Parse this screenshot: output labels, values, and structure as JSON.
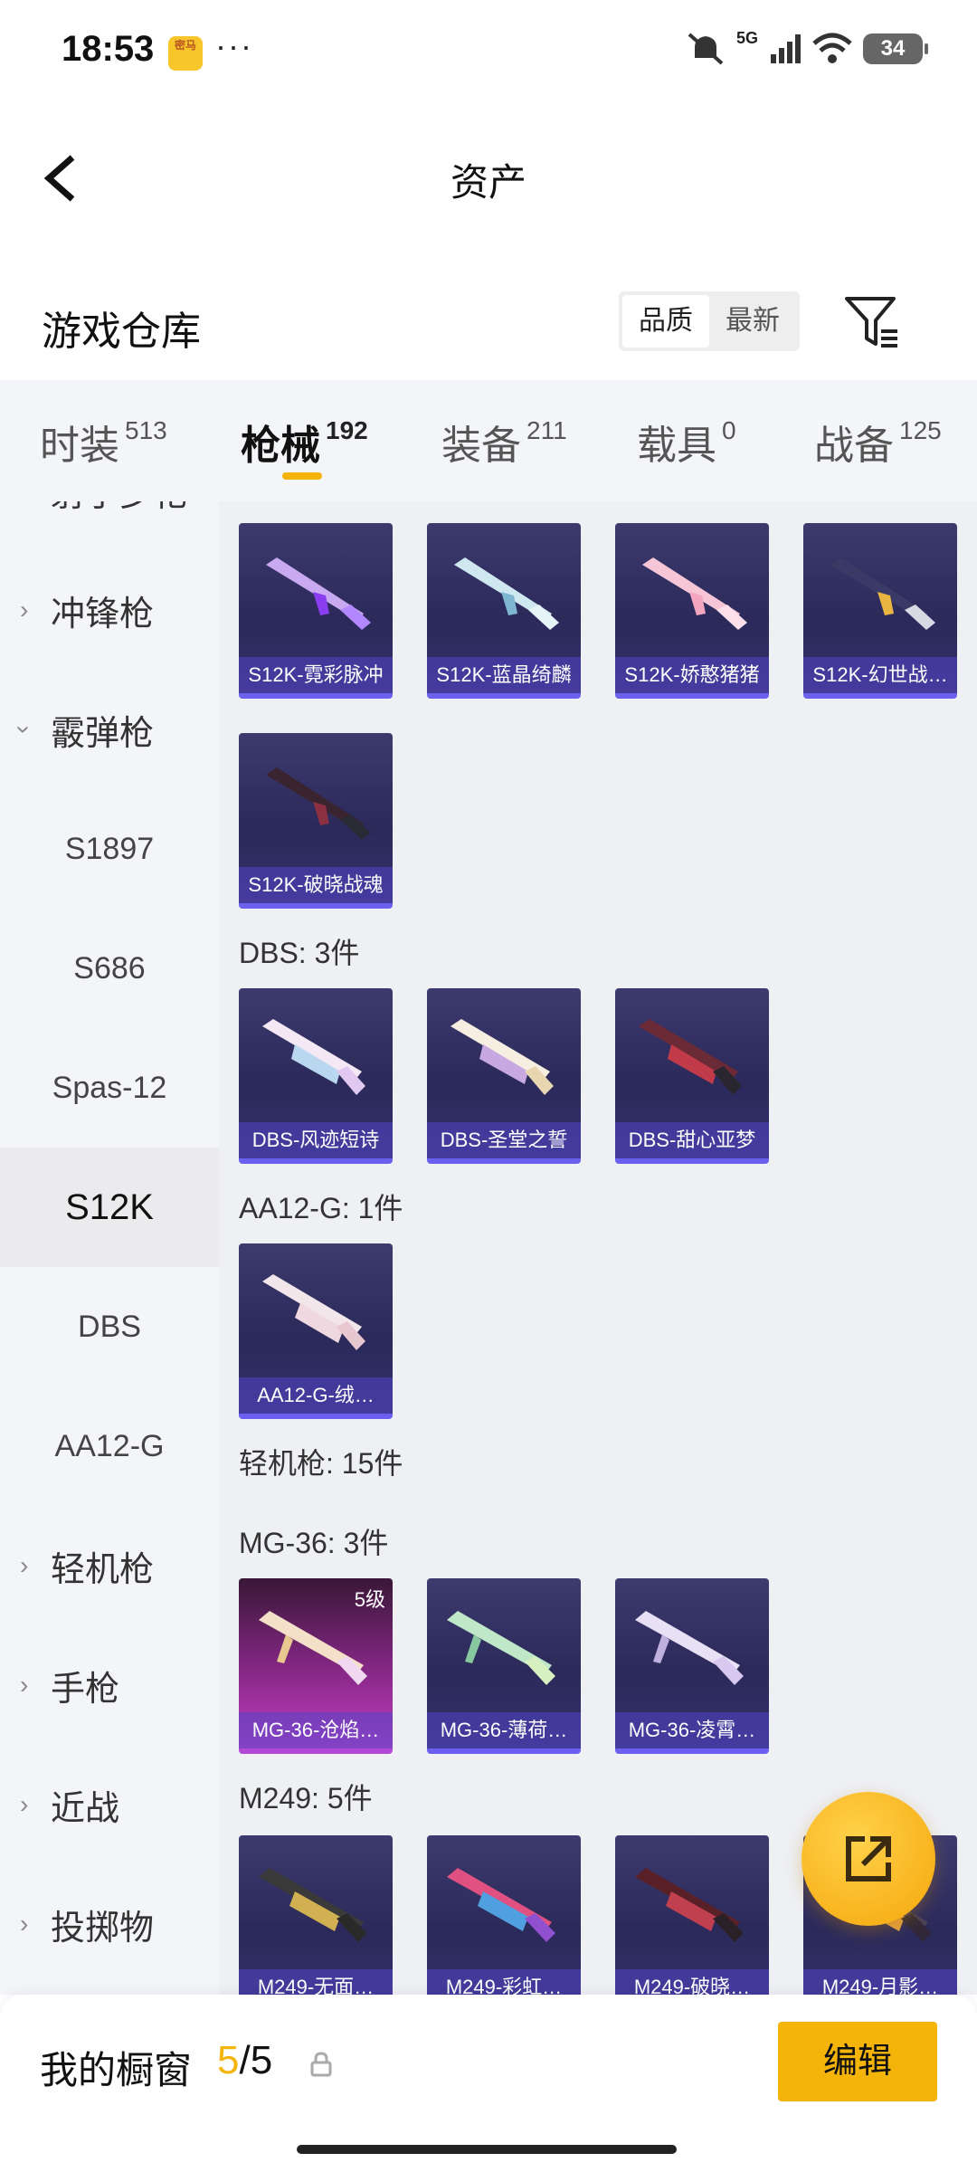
{
  "status": {
    "time": "18:53",
    "app_icon_text": "密马",
    "more": "···",
    "network": "5G",
    "battery": "34"
  },
  "header": {
    "title": "资产"
  },
  "warehouse": {
    "label": "游戏仓库",
    "sort_options": [
      "品质",
      "最新"
    ],
    "selected_sort": "品质"
  },
  "tabs": [
    {
      "label": "时装",
      "count": "513"
    },
    {
      "label": "枪械",
      "count": "192"
    },
    {
      "label": "装备",
      "count": "211"
    },
    {
      "label": "载具",
      "count": "0"
    },
    {
      "label": "战备",
      "count": "125"
    }
  ],
  "sidebar": {
    "top_partial": "射手步枪",
    "items": [
      {
        "label": "冲锋枪",
        "type": "group",
        "expanded": false
      },
      {
        "label": "霰弹枪",
        "type": "group",
        "expanded": true
      },
      {
        "label": "S1897",
        "type": "sub"
      },
      {
        "label": "S686",
        "type": "sub"
      },
      {
        "label": "Spas-12",
        "type": "sub"
      },
      {
        "label": "S12K",
        "type": "sub",
        "selected": true
      },
      {
        "label": "DBS",
        "type": "sub"
      },
      {
        "label": "AA12-G",
        "type": "sub"
      },
      {
        "label": "轻机枪",
        "type": "group",
        "expanded": false
      },
      {
        "label": "手枪",
        "type": "group",
        "expanded": false
      },
      {
        "label": "近战",
        "type": "group",
        "expanded": false
      },
      {
        "label": "投掷物",
        "type": "group",
        "expanded": false
      }
    ]
  },
  "content": {
    "s12k_items": [
      "S12K-霓彩脉冲",
      "S12K-蓝晶绮麟",
      "S12K-娇憨猪猪",
      "S12K-幻世战…",
      "S12K-破晓战魂"
    ],
    "dbs_header": "DBS: 3件",
    "dbs_items": [
      "DBS-风迹短诗",
      "DBS-圣堂之誓",
      "DBS-甜心亚梦"
    ],
    "aa12_header": "AA12-G: 1件",
    "aa12_items": [
      "AA12-G-绒…"
    ],
    "lmg_header": "轻机枪: 15件",
    "mg36_header": "MG-36: 3件",
    "mg36_items": [
      "MG-36-沧焰…",
      "MG-36-薄荷…",
      "MG-36-凌霄…"
    ],
    "mg36_level": "5级",
    "m249_header": "M249: 5件",
    "m249_items": [
      "M249-无面…",
      "M249-彩虹…",
      "M249-破晓…",
      "M249-月影…"
    ]
  },
  "bottom": {
    "label": "我的橱窗",
    "current": "5",
    "sep_total": "/5",
    "edit_label": "编辑"
  },
  "colors": {
    "accent": "#f5b40a",
    "card_bg": "#2b2a5a",
    "card_border": "#6b5ff0",
    "gold_card": "#c13fc1"
  }
}
